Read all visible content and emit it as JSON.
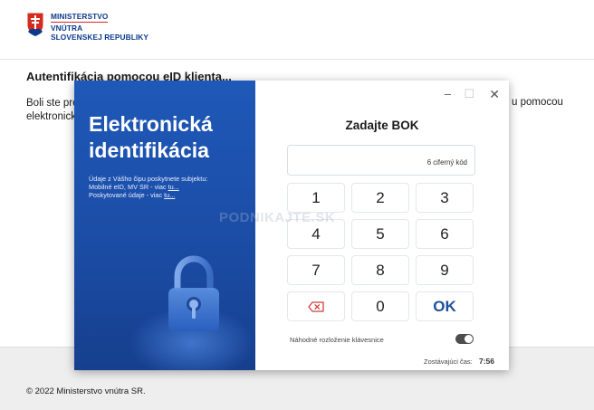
{
  "header": {
    "logo_line1": "MINISTERSTVO",
    "logo_line2": "VNÚTRA",
    "logo_line3": "SLOVENSKEJ REPUBLIKY"
  },
  "auth": {
    "title": "Autentifikácia pomocou eID klienta...",
    "body_line1": "Boli ste pre",
    "body_line2": "elektronick",
    "body_right": "u pomocou"
  },
  "footer": {
    "copyright": "© 2022 Ministerstvo vnútra SR."
  },
  "modal": {
    "title_line1": "Elektronická",
    "title_line2": "identifikácia",
    "info_line1": "Údaje z Vášho čipu poskytnete subjektu:",
    "info_line2_prefix": "Mobilné eID, MV SR - viac ",
    "info_line2_link": "tu...",
    "info_line3_prefix": "Poskytované údaje - viac ",
    "info_line3_link": "tu...",
    "window_minimize": "–",
    "window_maximize": "☐",
    "window_close": "✕",
    "bok_title": "Zadajte BOK",
    "bok_placeholder": "6 ciferný kód",
    "keys": [
      "1",
      "2",
      "3",
      "4",
      "5",
      "6",
      "7",
      "8",
      "9",
      "0"
    ],
    "ok_label": "OK",
    "backspace_icon": "backspace-icon",
    "random_layout_label": "Náhodné rozloženie klávesnice",
    "remaining_time_label": "Zostávajúci čas:",
    "remaining_time_value": "7:56"
  },
  "watermark": "PODNIKAJTE.SK",
  "colors": {
    "brand_blue": "#1f58b8",
    "ok_blue": "#1f4f9e",
    "backspace_red": "#d23b3b",
    "logo_blue": "#0b3a8c",
    "logo_red": "#d52b1e"
  }
}
